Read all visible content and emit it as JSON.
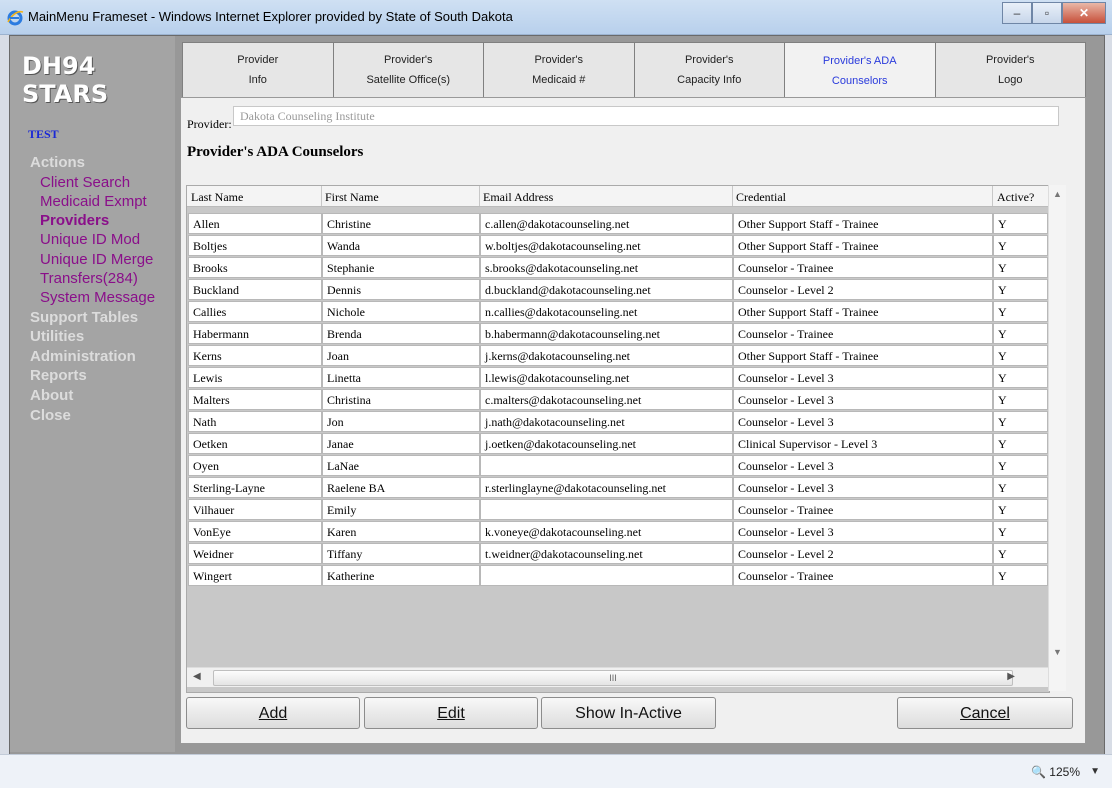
{
  "window": {
    "title": "MainMenu Frameset - Windows Internet Explorer provided by State of South Dakota",
    "zoom": "125%"
  },
  "sidebar": {
    "logo_line1": "DH94",
    "logo_line2": "STARS",
    "env": "TEST",
    "sections": [
      {
        "label": "Actions",
        "items": [
          "Client Search",
          "Medicaid Exmpt",
          "Providers",
          "Unique ID Mod",
          "Unique ID Merge",
          "Transfers(284)",
          "System Message"
        ]
      },
      {
        "label": "Support Tables"
      },
      {
        "label": "Utilities"
      },
      {
        "label": "Administration"
      },
      {
        "label": "Reports"
      },
      {
        "label": "About"
      },
      {
        "label": "Close"
      }
    ],
    "active_item": "Providers"
  },
  "tabs": [
    {
      "line1": "Provider",
      "line2": "Info"
    },
    {
      "line1": "Provider's",
      "line2": "Satellite Office(s)"
    },
    {
      "line1": "Provider's",
      "line2": "Medicaid #"
    },
    {
      "line1": "Provider's",
      "line2": "Capacity Info"
    },
    {
      "line1": "Provider's ADA",
      "line2": "Counselors"
    },
    {
      "line1": "Provider's",
      "line2": "Logo"
    }
  ],
  "active_tab": 4,
  "provider": {
    "label": "Provider:",
    "value": "Dakota Counseling Institute"
  },
  "heading": "Provider's ADA Counselors",
  "table": {
    "columns": [
      "Last Name",
      "First Name",
      "Email Address",
      "Credential",
      "Active?"
    ],
    "rows": [
      [
        "Allen",
        "Christine",
        "c.allen@dakotacounseling.net",
        "Other Support Staff - Trainee",
        "Y"
      ],
      [
        "Boltjes",
        "Wanda",
        "w.boltjes@dakotacounseling.net",
        "Other Support Staff - Trainee",
        "Y"
      ],
      [
        "Brooks",
        "Stephanie",
        "s.brooks@dakotacounseling.net",
        "Counselor - Trainee",
        "Y"
      ],
      [
        "Buckland",
        "Dennis",
        "d.buckland@dakotacounseling.net",
        "Counselor - Level 2",
        "Y"
      ],
      [
        "Callies",
        "Nichole",
        "n.callies@dakotacounseling.net",
        "Other Support Staff - Trainee",
        "Y"
      ],
      [
        "Habermann",
        "Brenda",
        "b.habermann@dakotacounseling.net",
        "Counselor - Trainee",
        "Y"
      ],
      [
        "Kerns",
        "Joan",
        "j.kerns@dakotacounseling.net",
        "Other Support Staff - Trainee",
        "Y"
      ],
      [
        "Lewis",
        "Linetta",
        "l.lewis@dakotacounseling.net",
        "Counselor - Level 3",
        "Y"
      ],
      [
        "Malters",
        "Christina",
        "c.malters@dakotacounseling.net",
        "Counselor - Level 3",
        "Y"
      ],
      [
        "Nath",
        "Jon",
        "j.nath@dakotacounseling.net",
        "Counselor - Level 3",
        "Y"
      ],
      [
        "Oetken",
        "Janae",
        "j.oetken@dakotacounseling.net",
        "Clinical Supervisor - Level 3",
        "Y"
      ],
      [
        "Oyen",
        "LaNae",
        "",
        "Counselor - Level 3",
        "Y"
      ],
      [
        "Sterling-Layne",
        "Raelene BA",
        "r.sterlinglayne@dakotacounseling.net",
        "Counselor - Level 3",
        "Y"
      ],
      [
        "Vilhauer",
        "Emily",
        "",
        "Counselor - Trainee",
        "Y"
      ],
      [
        "VonEye",
        "Karen",
        "k.voneye@dakotacounseling.net",
        "Counselor - Level 3",
        "Y"
      ],
      [
        "Weidner",
        "Tiffany",
        "t.weidner@dakotacounseling.net",
        "Counselor - Level 2",
        "Y"
      ],
      [
        "Wingert",
        "Katherine",
        "",
        "Counselor - Trainee",
        "Y"
      ]
    ]
  },
  "buttons": {
    "add": "Add",
    "edit": "Edit",
    "show_inactive": "Show In-Active",
    "cancel": "Cancel"
  },
  "colors": {
    "menu_item": "#8a0f8a",
    "active_tab_text": "#2a3bdc",
    "env_text": "#1a28d6"
  }
}
